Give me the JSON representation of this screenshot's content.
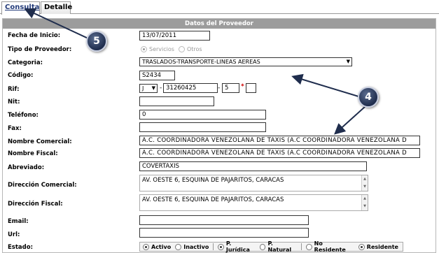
{
  "tabs": [
    {
      "label": "Consulta"
    },
    {
      "label": "Detalle"
    }
  ],
  "panel": {
    "title": "Datos del Proveedor"
  },
  "labels": {
    "fecha_inicio": "Fecha de Inicio:",
    "tipo_proveedor": "Tipo de Proveedor:",
    "categoria": "Categoria:",
    "codigo": "Código:",
    "rif": "Rif:",
    "nit": "Nit:",
    "telefono": "Teléfono:",
    "fax": "Fax:",
    "nombre_comercial": "Nombre Comercial:",
    "nombre_fiscal": "Nombre Fiscal:",
    "abreviado": "Abreviado:",
    "direccion_comercial": "Dirección Comercial:",
    "direccion_fiscal": "Dirección Fiscal:",
    "email": "Email:",
    "url": "Url:",
    "estado": "Estado:"
  },
  "values": {
    "fecha_inicio": "13/07/2011",
    "tipo_servicios": "Servicios",
    "tipo_otros": "Otros",
    "categoria": "TRASLADOS-TRANSPORTE-LINEAS AEREAS",
    "codigo": "S2434",
    "rif_tipo": "J",
    "rif_numero": "31260425",
    "rif_digito": "5",
    "rif_required": "*",
    "nit": "",
    "telefono": "0",
    "fax": "",
    "nombre_comercial": "A.C. COORDINADORA VENEZOLANA DE TAXIS (A.C COORDINADORA VENEZOLANA D",
    "nombre_fiscal": "A.C. COORDINADORA VENEZOLANA DE TAXIS (A.C COORDINADORA VENEZOLANA D",
    "abreviado": "COVERTAXIS",
    "direccion_comercial": "AV. OESTE 6, ESQUINA DE PAJARITOS, CARACAS",
    "direccion_fiscal": "AV. OESTE 6, ESQUINA DE PAJARITOS, CARACAS",
    "email": "",
    "url": ""
  },
  "estado_options": {
    "activo": "Activo",
    "inactivo": "Inactivo",
    "p_juridica": "P. Jurídica",
    "p_natural": "P. Natural",
    "no_residente": "No Residente",
    "residente": "Residente"
  },
  "callouts": {
    "five": "5",
    "four": "4"
  },
  "colors": {
    "header_bg": "#9c9c9c",
    "tab_active_text": "#233b7a",
    "callout_bg": "#1f2d4d",
    "required_mark": "#d00000"
  }
}
